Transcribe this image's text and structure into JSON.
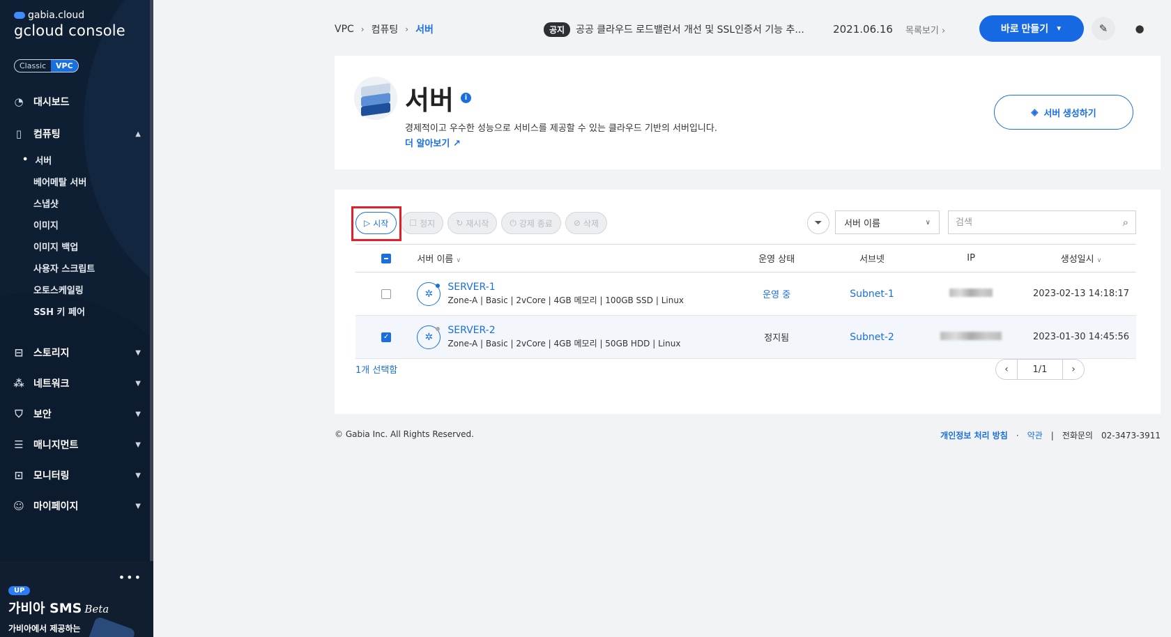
{
  "brand": {
    "top": "gabia.cloud",
    "console": "gcloud console",
    "toggle_classic": "Classic",
    "toggle_vpc": "VPC"
  },
  "sidebar": {
    "items": [
      {
        "label": "대시보드"
      },
      {
        "label": "컴퓨팅"
      },
      {
        "label": "스토리지"
      },
      {
        "label": "네트워크"
      },
      {
        "label": "보안"
      },
      {
        "label": "매니지먼트"
      },
      {
        "label": "모니터링"
      },
      {
        "label": "마이페이지"
      }
    ],
    "sub_items": [
      {
        "label": "서버"
      },
      {
        "label": "베어메탈 서버"
      },
      {
        "label": "스냅샷"
      },
      {
        "label": "이미지"
      },
      {
        "label": "이미지 백업"
      },
      {
        "label": "사용자 스크립트"
      },
      {
        "label": "오토스케일링"
      },
      {
        "label": "SSH 키 페어"
      }
    ]
  },
  "promo": {
    "badge": "UP",
    "title": "가비아 SMS",
    "title_suffix": "Beta",
    "desc": "가비아에서 제공하는"
  },
  "topbar": {
    "breadcrumb": [
      "VPC",
      "컴퓨팅",
      "서버"
    ],
    "notice_tag": "공지",
    "notice_text": "공공 클라우드 로드밸런서 개선 및 SSL인증서 기능 추...",
    "notice_date": "2021.06.16",
    "notice_list": "목록보기",
    "make_button": "바로 만들기"
  },
  "header": {
    "title": "서버",
    "desc": "경제적이고 우수한 성능으로 서비스를 제공할 수 있는 클라우드 기반의 서버입니다.",
    "more": "더 알아보기",
    "create_button": "서버 생성하기"
  },
  "actions": {
    "start": "시작",
    "stop": "정지",
    "restart": "재시작",
    "force_stop": "강제 종료",
    "delete": "삭제"
  },
  "filter": {
    "select_value": "서버 이름",
    "search_placeholder": "검색"
  },
  "table": {
    "headers": {
      "name": "서버 이름",
      "status": "운영 상태",
      "subnet": "서브넷",
      "ip": "IP",
      "created": "생성일시"
    },
    "rows": [
      {
        "name": "SERVER-1",
        "spec": "Zone-A  |  Basic  |  2vCore  |  4GB 메모리  |  100GB SSD  |  Linux",
        "status": "운영 중",
        "subnet": "Subnet-1",
        "created": "2023-02-13 14:18:17",
        "selected": false
      },
      {
        "name": "SERVER-2",
        "spec": "Zone-A  |  Basic  |  2vCore  |  4GB 메모리  |  50GB HDD  |  Linux",
        "status": "정지됨",
        "subnet": "Subnet-2",
        "created": "2023-01-30 14:45:56",
        "selected": true
      }
    ],
    "selected_count": "1개 선택함",
    "page": "1/1"
  },
  "footer": {
    "copyright": "© Gabia Inc. All Rights Reserved.",
    "privacy": "개인정보 처리 방침",
    "terms": "약관",
    "phone_label": "전화문의",
    "phone": "02-3473-3911"
  },
  "colors": {
    "accent": "#1a6fe0",
    "sidebar_bg": "#0f1f33",
    "highlight": "#e0202a"
  }
}
